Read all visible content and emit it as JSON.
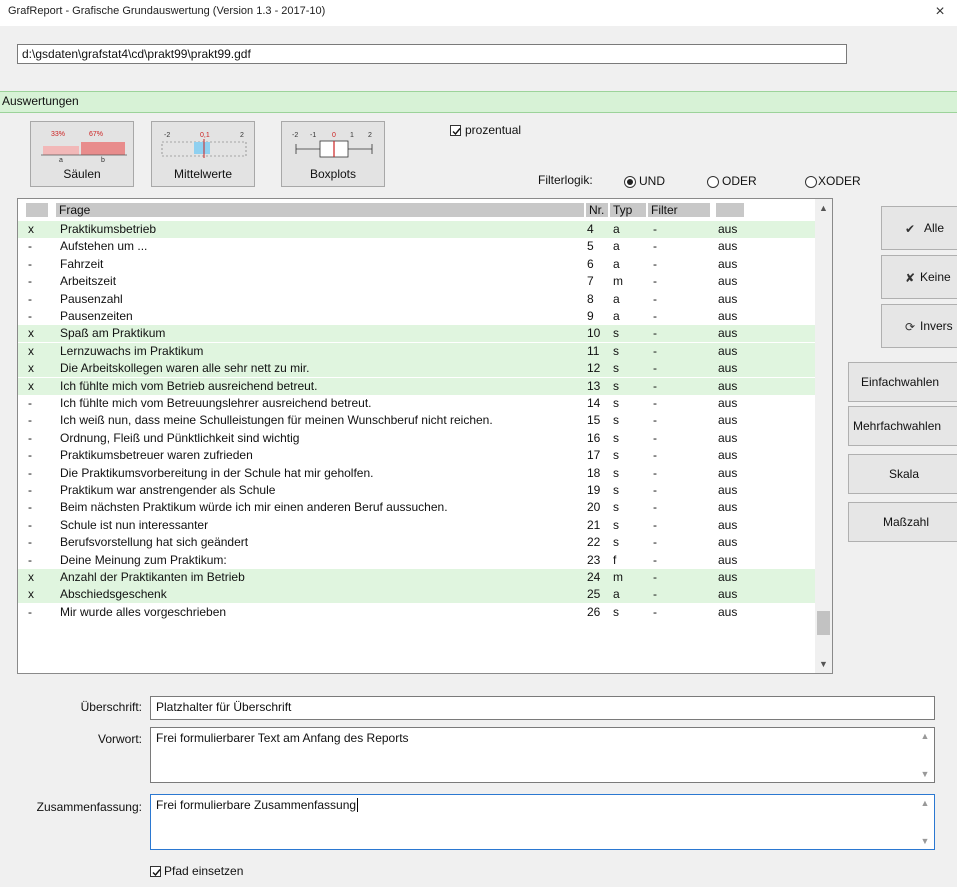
{
  "window": {
    "title": "GrafReport - Grafische Grundauswertung  (Version 1.3 - 2017-10)",
    "close_glyph": "×",
    "path": "d:\\gsdaten\\grafstat4\\cd\\prakt99\\prakt99.gdf"
  },
  "section_title": "Auswertungen",
  "chart_buttons": {
    "saeulen": {
      "label": "Säulen",
      "icon_texts": [
        "33%",
        "67%",
        "a",
        "b"
      ]
    },
    "mittelwerte": {
      "label": "Mittelwerte",
      "icon_texts": [
        "-2",
        "0,1",
        "2"
      ]
    },
    "boxplots": {
      "label": "Boxplots",
      "icon_texts": [
        "-2",
        "-1",
        "0",
        "1",
        "2"
      ]
    }
  },
  "prozentual": {
    "label": "prozentual",
    "checked": true
  },
  "filterlogik": {
    "label": "Filterlogik:",
    "options": [
      "UND",
      "ODER",
      "XODER"
    ],
    "selected": "UND"
  },
  "list": {
    "headers": {
      "frage": "Frage",
      "nr": "Nr.",
      "typ": "Typ",
      "filter": "Filter"
    },
    "rows": [
      {
        "mark": "x",
        "frage": "Praktikumsbetrieb",
        "nr": "4",
        "typ": "a",
        "filter": "-",
        "status": "aus",
        "selected": true
      },
      {
        "mark": "-",
        "frage": "Aufstehen um ...",
        "nr": "5",
        "typ": "a",
        "filter": "-",
        "status": "aus",
        "selected": false
      },
      {
        "mark": "-",
        "frage": "Fahrzeit",
        "nr": "6",
        "typ": "a",
        "filter": "-",
        "status": "aus",
        "selected": false
      },
      {
        "mark": "-",
        "frage": "Arbeitszeit",
        "nr": "7",
        "typ": "m",
        "filter": "-",
        "status": "aus",
        "selected": false
      },
      {
        "mark": "-",
        "frage": "Pausenzahl",
        "nr": "8",
        "typ": "a",
        "filter": "-",
        "status": "aus",
        "selected": false
      },
      {
        "mark": "-",
        "frage": "Pausenzeiten",
        "nr": "9",
        "typ": "a",
        "filter": "-",
        "status": "aus",
        "selected": false
      },
      {
        "mark": "x",
        "frage": "Spaß am Praktikum",
        "nr": "10",
        "typ": "s",
        "filter": "-",
        "status": "aus",
        "selected": true
      },
      {
        "mark": "x",
        "frage": "Lernzuwachs im Praktikum",
        "nr": "11",
        "typ": "s",
        "filter": "-",
        "status": "aus",
        "selected": true
      },
      {
        "mark": "x",
        "frage": "Die Arbeitskollegen waren alle sehr nett zu mir.",
        "nr": "12",
        "typ": "s",
        "filter": "-",
        "status": "aus",
        "selected": true
      },
      {
        "mark": "x",
        "frage": "Ich fühlte mich vom Betrieb ausreichend betreut.",
        "nr": "13",
        "typ": "s",
        "filter": "-",
        "status": "aus",
        "selected": true
      },
      {
        "mark": "-",
        "frage": "Ich fühlte mich vom Betreuungslehrer ausreichend betreut.",
        "nr": "14",
        "typ": "s",
        "filter": "-",
        "status": "aus",
        "selected": false
      },
      {
        "mark": "-",
        "frage": "Ich weiß nun, dass meine Schulleistungen für meinen Wunschberuf nicht reichen.",
        "nr": "15",
        "typ": "s",
        "filter": "-",
        "status": "aus",
        "selected": false
      },
      {
        "mark": "-",
        "frage": "Ordnung, Fleiß und Pünktlichkeit sind wichtig",
        "nr": "16",
        "typ": "s",
        "filter": "-",
        "status": "aus",
        "selected": false
      },
      {
        "mark": "-",
        "frage": "Praktikumsbetreuer waren zufrieden",
        "nr": "17",
        "typ": "s",
        "filter": "-",
        "status": "aus",
        "selected": false
      },
      {
        "mark": "-",
        "frage": "Die Praktikumsvorbereitung in der Schule hat mir geholfen.",
        "nr": "18",
        "typ": "s",
        "filter": "-",
        "status": "aus",
        "selected": false
      },
      {
        "mark": "-",
        "frage": "Praktikum war anstrengender als Schule",
        "nr": "19",
        "typ": "s",
        "filter": "-",
        "status": "aus",
        "selected": false
      },
      {
        "mark": "-",
        "frage": "Beim nächsten Praktikum würde ich mir einen anderen Beruf aussuchen.",
        "nr": "20",
        "typ": "s",
        "filter": "-",
        "status": "aus",
        "selected": false
      },
      {
        "mark": "-",
        "frage": "Schule ist nun interessanter",
        "nr": "21",
        "typ": "s",
        "filter": "-",
        "status": "aus",
        "selected": false
      },
      {
        "mark": "-",
        "frage": "Berufsvorstellung hat sich geändert",
        "nr": "22",
        "typ": "s",
        "filter": "-",
        "status": "aus",
        "selected": false
      },
      {
        "mark": "-",
        "frage": "Deine Meinung zum Praktikum:",
        "nr": "23",
        "typ": "f",
        "filter": "-",
        "status": "aus",
        "selected": false
      },
      {
        "mark": "x",
        "frage": "Anzahl der Praktikanten im Betrieb",
        "nr": "24",
        "typ": "m",
        "filter": "-",
        "status": "aus",
        "selected": true
      },
      {
        "mark": "x",
        "frage": "Abschiedsgeschenk",
        "nr": "25",
        "typ": "a",
        "filter": "-",
        "status": "aus",
        "selected": true
      },
      {
        "mark": "-",
        "frage": "Mir wurde alles vorgeschrieben",
        "nr": "26",
        "typ": "s",
        "filter": "-",
        "status": "aus",
        "selected": false
      }
    ]
  },
  "side_buttons": {
    "alle": "Alle",
    "keine": "Keine",
    "invers": "Invers",
    "einfachwahlen": "Einfachwahlen",
    "mehrfachwahlen": "Mehrfachwahlen",
    "skala": "Skala",
    "masszahl": "Maßzahl"
  },
  "form": {
    "ueberschrift_label": "Überschrift:",
    "ueberschrift_value": "Platzhalter für Überschrift",
    "vorwort_label": "Vorwort:",
    "vorwort_value": "Frei formulierbarer Text am Anfang des Reports",
    "zusammenfassung_label": "Zusammenfassung:",
    "zusammenfassung_value": "Frei formulierbare Zusammenfassung",
    "pfad_label": "Pfad einsetzen",
    "pfad_checked": true
  },
  "colors": {
    "accent_green": "#d7f2d6",
    "row_selected": "#e0f5df",
    "focus_blue": "#2b78d1"
  }
}
